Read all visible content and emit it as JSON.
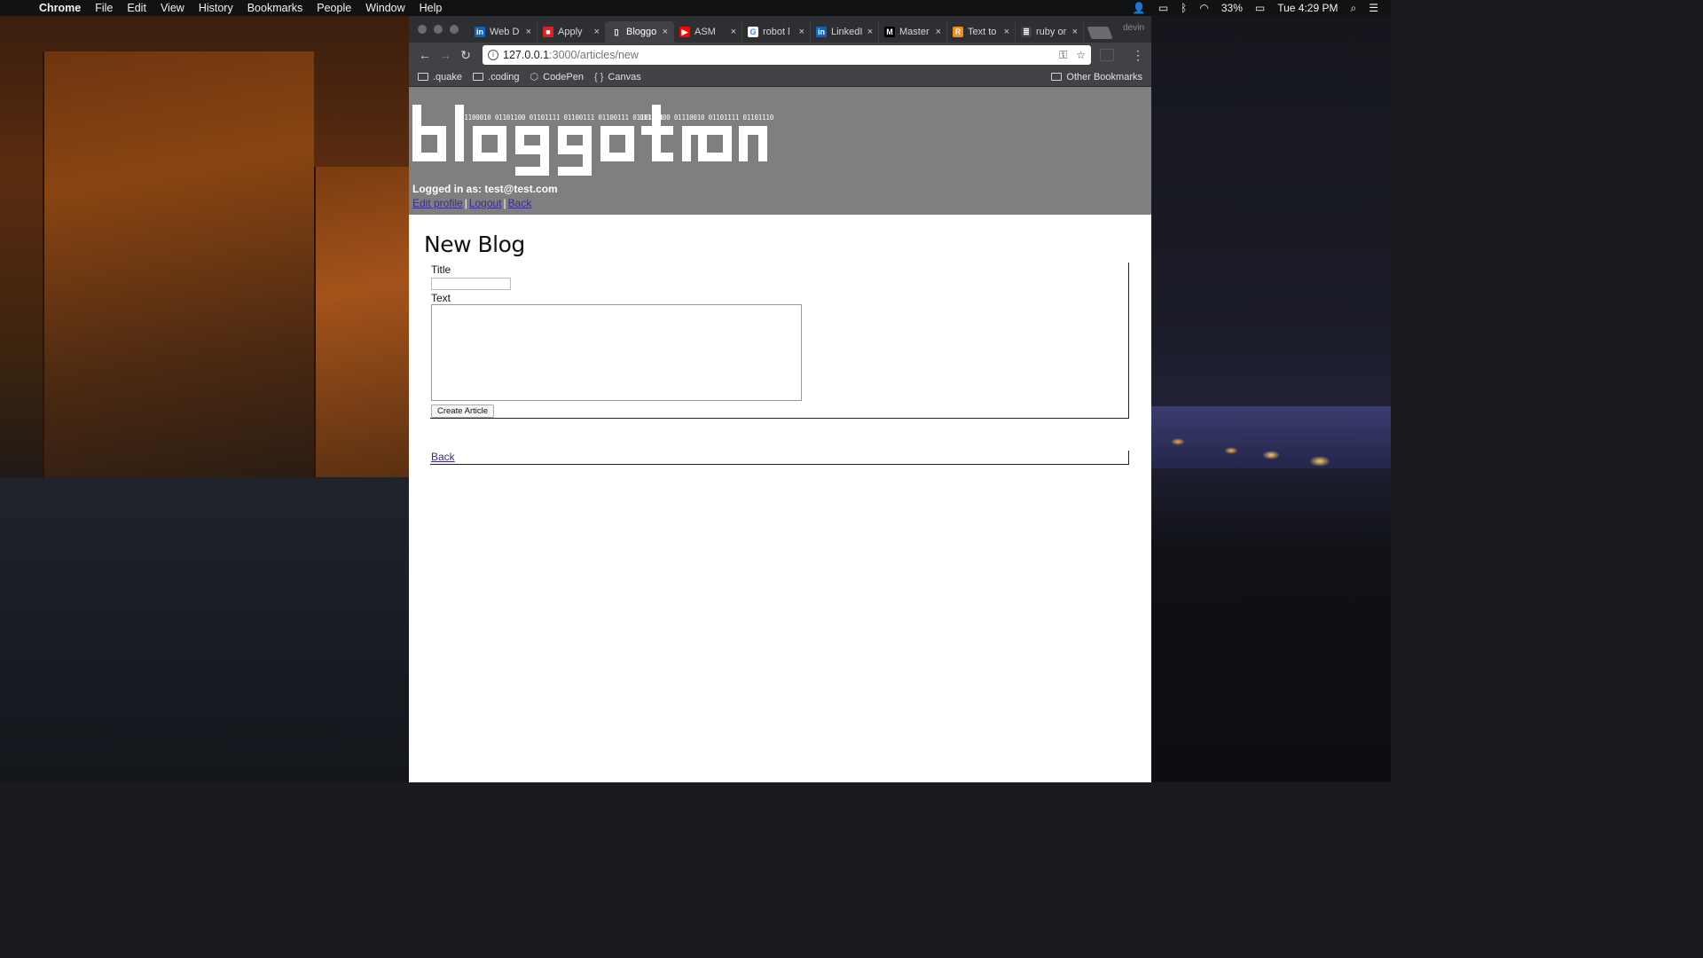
{
  "menubar": {
    "app": "Chrome",
    "items": [
      "File",
      "Edit",
      "View",
      "History",
      "Bookmarks",
      "People",
      "Window",
      "Help"
    ],
    "battery": "33%",
    "clock": "Tue 4:29 PM"
  },
  "browser": {
    "tabs": [
      {
        "label": "Web D",
        "favicon": "linkedin-icon",
        "color": "#0a66c2",
        "glyph": "in"
      },
      {
        "label": "Apply",
        "favicon": "apply-icon",
        "color": "#e02020",
        "glyph": "■"
      },
      {
        "label": "Bloggo",
        "favicon": "page-icon",
        "color": "#414246",
        "glyph": "▯",
        "active": true
      },
      {
        "label": "ASM",
        "favicon": "youtube-icon",
        "color": "#ff0000",
        "glyph": "▶"
      },
      {
        "label": "robot l",
        "favicon": "google-icon",
        "color": "#ffffff",
        "glyph": "G"
      },
      {
        "label": "LinkedI",
        "favicon": "linkedin-icon",
        "color": "#0a66c2",
        "glyph": "in"
      },
      {
        "label": "Master",
        "favicon": "medium-icon",
        "color": "#000000",
        "glyph": "M"
      },
      {
        "label": "Text to",
        "favicon": "r-icon",
        "color": "#f28b1a",
        "glyph": "R"
      },
      {
        "label": "ruby or",
        "favicon": "stackoverflow-icon",
        "color": "#414246",
        "glyph": "≣"
      }
    ],
    "profile": "devin",
    "url_host": "127.0.0.1",
    "url_path": ":3000/articles/new",
    "bookmarks": [
      {
        "label": ".quake",
        "type": "folder"
      },
      {
        "label": ".coding",
        "type": "folder"
      },
      {
        "label": "CodePen",
        "type": "codepen"
      },
      {
        "label": "Canvas",
        "type": "canvas"
      }
    ],
    "other_bookmarks": "Other Bookmarks"
  },
  "site": {
    "logo_text": "bloggotron",
    "binary_1": "01100010 01101100 01101111 01100111 01100111 01101111",
    "binary_2": "01110100 01110010 01101111 01101110",
    "logged_in": "Logged in as: test@test.com",
    "links": {
      "edit_profile": "Edit profile",
      "logout": "Logout",
      "back": "Back"
    }
  },
  "form": {
    "heading": "New Blog",
    "title_label": "Title",
    "title_value": "",
    "text_label": "Text",
    "text_value": "",
    "submit_label": "Create Article",
    "back_link": "Back"
  }
}
